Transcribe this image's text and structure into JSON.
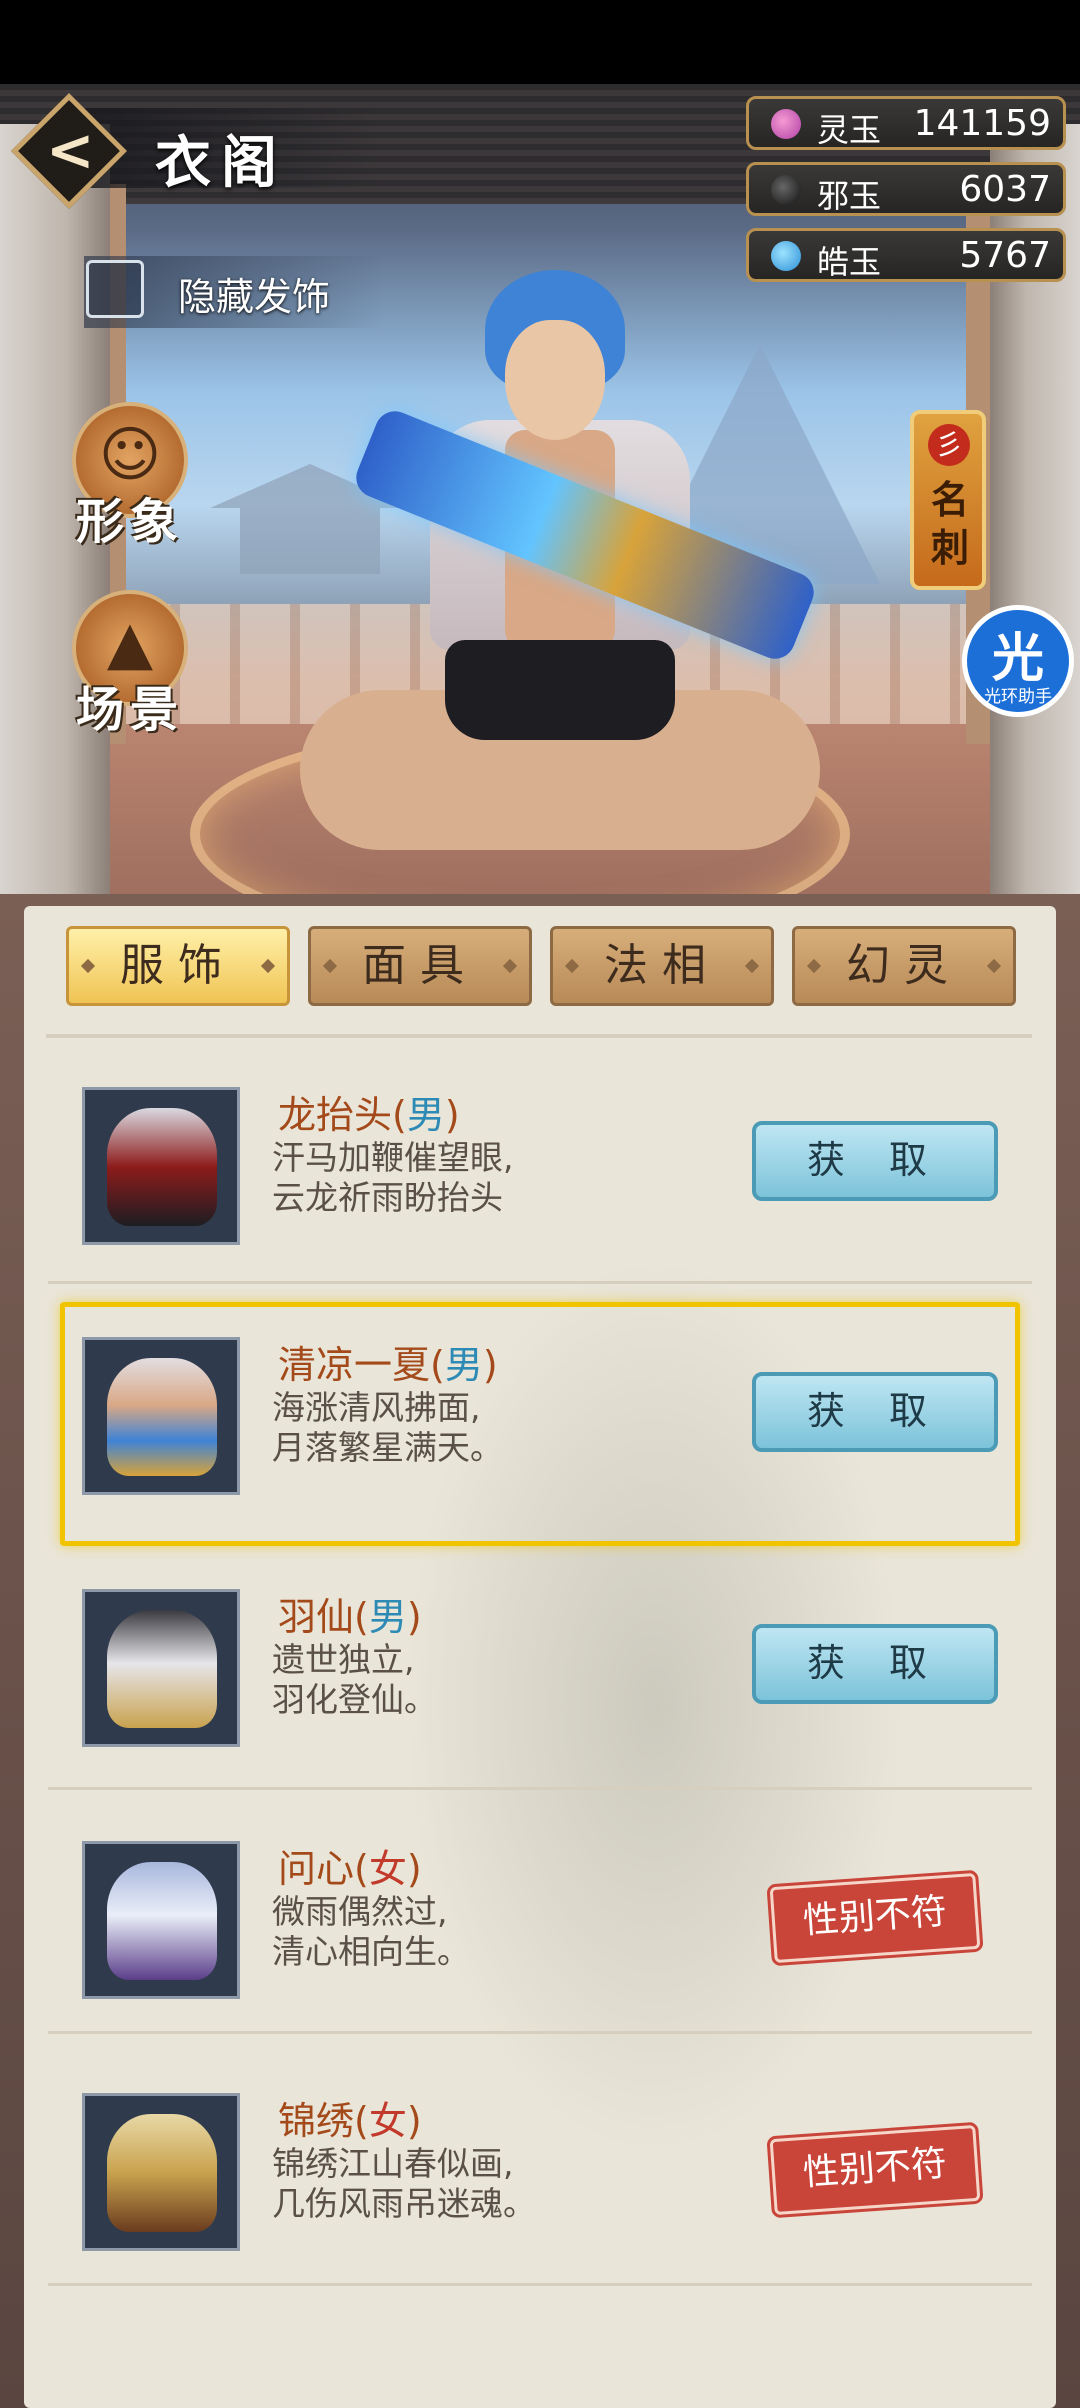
{
  "header": {
    "title": "衣阁",
    "back_label": "<"
  },
  "currencies": [
    {
      "name": "灵玉",
      "value": "141159",
      "icon": "spirit-jade-icon"
    },
    {
      "name": "邪玉",
      "value": "6037",
      "icon": "evil-jade-icon"
    },
    {
      "name": "皓玉",
      "value": "5767",
      "icon": "bright-jade-icon"
    }
  ],
  "hide_accessory": {
    "label": "隐藏发饰",
    "checked": false
  },
  "side_buttons": [
    {
      "label": "形象",
      "icon": "portrait-icon"
    },
    {
      "label": "场景",
      "icon": "scene-icon"
    }
  ],
  "name_card": {
    "label": "名刺",
    "seal": "彡"
  },
  "helper": {
    "big": "光",
    "small": "光环助手"
  },
  "tabs": [
    {
      "label": "服饰",
      "active": true
    },
    {
      "label": "面具",
      "active": false
    },
    {
      "label": "法相",
      "active": false
    },
    {
      "label": "幻灵",
      "active": false
    }
  ],
  "items": [
    {
      "name": "龙抬头",
      "gender": "男",
      "desc1": "汗马加鞭催望眼,",
      "desc2": "云龙祈雨盼抬头",
      "action": "获 取"
    },
    {
      "name": "清凉一夏",
      "gender": "男",
      "desc1": "海涨清风拂面,",
      "desc2": "月落繁星满天。",
      "action": "获 取"
    },
    {
      "name": "羽仙",
      "gender": "男",
      "desc1": "遗世独立,",
      "desc2": "羽化登仙。",
      "action": "获 取"
    },
    {
      "name": "问心",
      "gender": "女",
      "desc1": "微雨偶然过,",
      "desc2": "清心相向生。",
      "action": "性别不符"
    },
    {
      "name": "锦绣",
      "gender": "女",
      "desc1": "锦绣江山春似画,",
      "desc2": "几伤风雨吊迷魂。",
      "action": "性别不符"
    }
  ],
  "colors": {
    "accent_gold": "#f0c400",
    "male": "#2c8ab5",
    "female": "#c23a2b",
    "name": "#a44a1a"
  }
}
